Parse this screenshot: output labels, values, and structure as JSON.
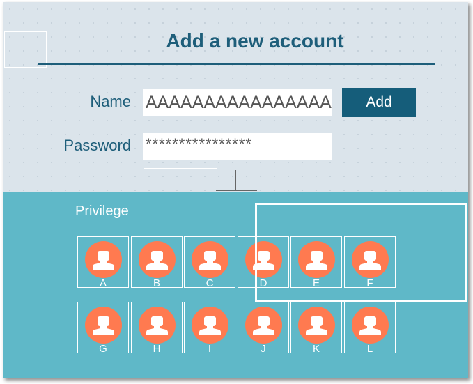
{
  "header": {
    "title": "Add a new account"
  },
  "form": {
    "name_label": "Name",
    "name_value": "AAAAAAAAAAAAAAAA",
    "password_label": "Password",
    "password_value": "****************",
    "add_label": "Add"
  },
  "privilege": {
    "label": "Privilege",
    "users": [
      "A",
      "B",
      "C",
      "D",
      "E",
      "F",
      "G",
      "H",
      "I",
      "J",
      "K",
      "L"
    ]
  },
  "colors": {
    "accent": "#1e5e7a",
    "button": "#155d7a",
    "avatar": "#ff7a50",
    "lower_panel": "#5fb8c8",
    "upper_panel": "#dbe4eb"
  }
}
